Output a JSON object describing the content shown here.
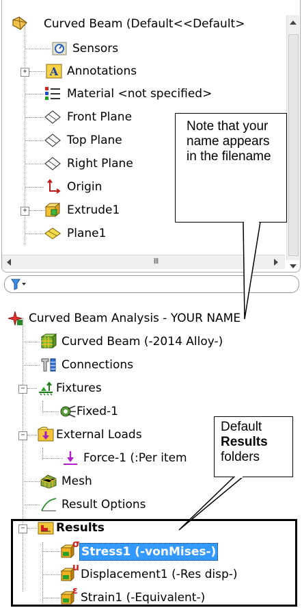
{
  "top_tree": {
    "root": "Curved Beam  (Default<<Default>",
    "items": [
      {
        "label": "Sensors",
        "icon": "sensor-icon"
      },
      {
        "label": "Annotations",
        "icon": "annotations-icon",
        "expander": "+"
      },
      {
        "label": "Material <not specified>",
        "icon": "material-icon"
      },
      {
        "label": "Front Plane",
        "icon": "plane-icon"
      },
      {
        "label": "Top Plane",
        "icon": "plane-icon"
      },
      {
        "label": "Right Plane",
        "icon": "plane-icon"
      },
      {
        "label": "Origin",
        "icon": "origin-icon"
      },
      {
        "label": "Extrude1",
        "icon": "extrude-icon",
        "expander": "+"
      },
      {
        "label": "Plane1",
        "icon": "plane-icon"
      }
    ],
    "scroll_thumb": "III"
  },
  "sim_tree": {
    "root": "Curved Beam Analysis - YOUR NAME",
    "items": [
      {
        "label": "Curved Beam (-2014 Alloy-)"
      },
      {
        "label": "Connections"
      },
      {
        "label": "Fixtures",
        "expander": "−"
      },
      {
        "label": "Fixed-1"
      },
      {
        "label": "External Loads",
        "expander": "−"
      },
      {
        "label": "Force-1 (:Per item"
      },
      {
        "label": "Mesh"
      },
      {
        "label": "Result Options"
      },
      {
        "label": "Results",
        "expander": "−"
      },
      {
        "label": "Stress1 (-vonMises-)",
        "superscript": "σ"
      },
      {
        "label": "Displacement1 (-Res disp-)",
        "superscript": "u"
      },
      {
        "label": "Strain1 (-Equivalent-)",
        "superscript": "ε"
      }
    ]
  },
  "callouts": {
    "name_note": "Note that your name appears in the filename",
    "results_pre": "Default",
    "results_bold": "Results",
    "results_post": "folders"
  },
  "colors": {
    "selection": "#3399ff",
    "accent": "#0a56b8"
  }
}
